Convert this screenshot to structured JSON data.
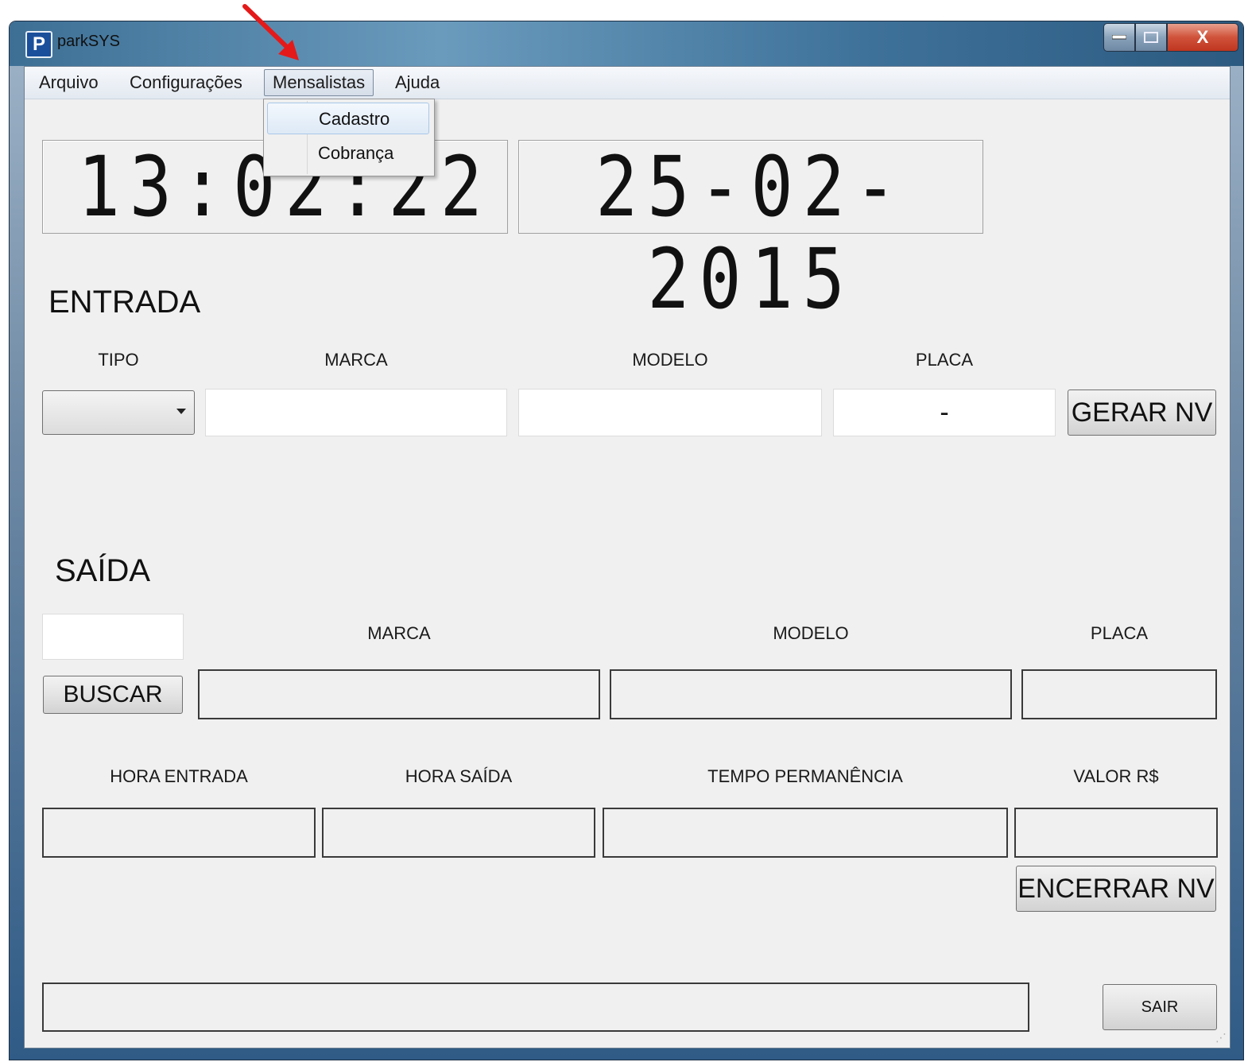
{
  "window": {
    "title": "parkSYS",
    "icon_letter": "P",
    "close_label": "X",
    "icon": "parking-app-icon"
  },
  "menubar": {
    "items": [
      "Arquivo",
      "Configurações",
      "Mensalistas",
      "Ajuda"
    ],
    "open_menu": "Mensalistas",
    "dropdown": [
      "Cadastro",
      "Cobrança"
    ],
    "hovered": "Cadastro"
  },
  "clock": {
    "time": "13:02:22",
    "date": "25-02-2015"
  },
  "entrada": {
    "title": "ENTRADA",
    "labels": {
      "tipo": "TIPO",
      "marca": "MARCA",
      "modelo": "MODELO",
      "placa": "PLACA"
    },
    "placa_value": "-",
    "button": "GERAR NV"
  },
  "saida": {
    "title": "SAÍDA",
    "search_button": "BUSCAR",
    "labels": {
      "marca": "MARCA",
      "modelo": "MODELO",
      "placa": "PLACA",
      "hora_entrada": "HORA ENTRADA",
      "hora_saida": "HORA SAÍDA",
      "tempo": "TEMPO PERMANÊNCIA",
      "valor": "VALOR R$"
    },
    "close_button": "ENCERRAR NV"
  },
  "footer": {
    "exit_button": "SAIR"
  },
  "colors": {
    "annotation_arrow": "#e41a1a",
    "title_bar": "#3d6f95"
  }
}
